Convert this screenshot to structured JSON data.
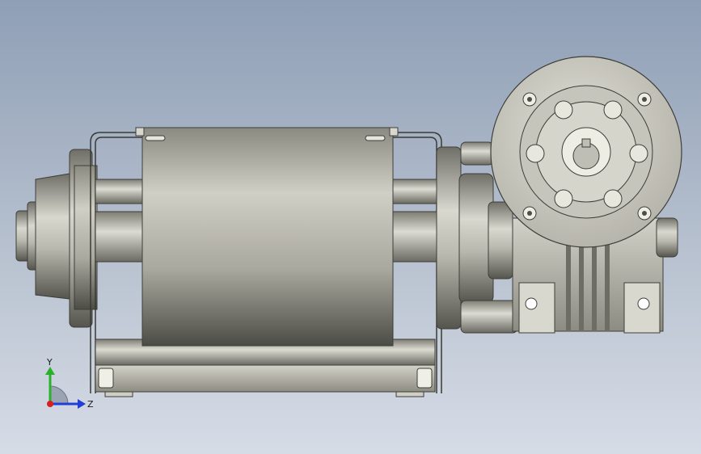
{
  "viewport": {
    "background_top": "#8f9fb6",
    "background_bottom": "#d6dce6"
  },
  "model": {
    "type": "geared motor assembly (motor with worm gearbox)",
    "part_color": "#c9c8bf",
    "shadow_color": "#5e5e57"
  },
  "triad": {
    "y_label": "Y",
    "z_label": "Z",
    "y_color": "#2ab02a",
    "z_color": "#1f3fd6",
    "x_color": "#d42020"
  }
}
